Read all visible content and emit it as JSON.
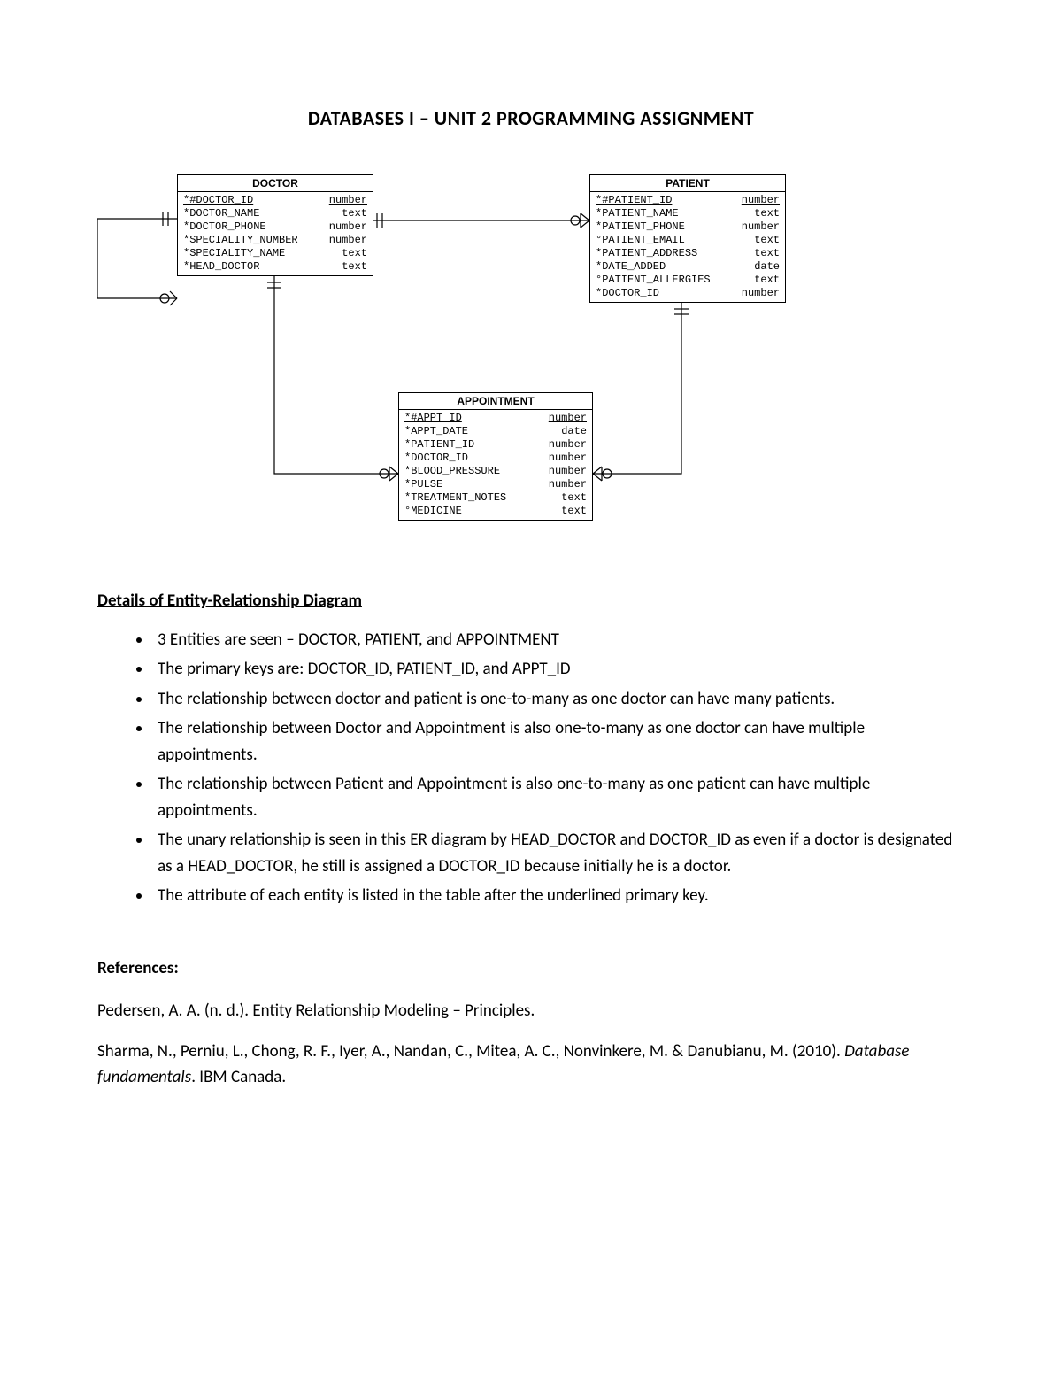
{
  "title": "DATABASES I – UNIT 2 PROGRAMMING ASSIGNMENT",
  "entities": {
    "doctor": {
      "name": "DOCTOR",
      "attributes": [
        {
          "prefix": "*#",
          "name": "DOCTOR_ID",
          "type": "number",
          "pk": true
        },
        {
          "prefix": "*",
          "name": "DOCTOR_NAME",
          "type": "text",
          "pk": false
        },
        {
          "prefix": "*",
          "name": "DOCTOR_PHONE",
          "type": "number",
          "pk": false
        },
        {
          "prefix": "*",
          "name": "SPECIALITY_NUMBER",
          "type": "number",
          "pk": false
        },
        {
          "prefix": "*",
          "name": "SPECIALITY_NAME",
          "type": "text",
          "pk": false
        },
        {
          "prefix": "*",
          "name": "HEAD_DOCTOR",
          "type": "text",
          "pk": false
        }
      ]
    },
    "patient": {
      "name": "PATIENT",
      "attributes": [
        {
          "prefix": "*#",
          "name": "PATIENT_ID",
          "type": "number",
          "pk": true
        },
        {
          "prefix": "*",
          "name": "PATIENT_NAME",
          "type": "text",
          "pk": false
        },
        {
          "prefix": "*",
          "name": "PATIENT_PHONE",
          "type": "number",
          "pk": false
        },
        {
          "prefix": "°",
          "name": "PATIENT_EMAIL",
          "type": "text",
          "pk": false
        },
        {
          "prefix": "*",
          "name": "PATIENT_ADDRESS",
          "type": "text",
          "pk": false
        },
        {
          "prefix": "*",
          "name": "DATE_ADDED",
          "type": "date",
          "pk": false
        },
        {
          "prefix": "°",
          "name": "PATIENT_ALLERGIES",
          "type": "text",
          "pk": false
        },
        {
          "prefix": "*",
          "name": "DOCTOR_ID",
          "type": "number",
          "pk": false
        }
      ]
    },
    "appointment": {
      "name": "APPOINTMENT",
      "attributes": [
        {
          "prefix": "*#",
          "name": "APPT_ID",
          "type": "number",
          "pk": true
        },
        {
          "prefix": "*",
          "name": "APPT_DATE",
          "type": "date",
          "pk": false
        },
        {
          "prefix": "*",
          "name": "PATIENT_ID",
          "type": "number",
          "pk": false
        },
        {
          "prefix": "*",
          "name": "DOCTOR_ID",
          "type": "number",
          "pk": false
        },
        {
          "prefix": "*",
          "name": "BLOOD_PRESSURE",
          "type": "number",
          "pk": false
        },
        {
          "prefix": "*",
          "name": "PULSE",
          "type": "number",
          "pk": false
        },
        {
          "prefix": "*",
          "name": "TREATMENT_NOTES",
          "type": "text",
          "pk": false
        },
        {
          "prefix": "°",
          "name": "MEDICINE",
          "type": "text",
          "pk": false
        }
      ]
    }
  },
  "details_heading": "Details of Entity-Relationship Diagram",
  "details": [
    "3 Entities are seen – DOCTOR, PATIENT, and APPOINTMENT",
    "The primary keys are: DOCTOR_ID, PATIENT_ID, and APPT_ID",
    "The relationship between doctor and patient is one-to-many as one doctor can have many patients.",
    "The relationship between Doctor and Appointment is also one-to-many as one doctor can have multiple appointments.",
    "The relationship between Patient and Appointment is also one-to-many as one patient can have multiple appointments.",
    "The unary relationship is seen in this ER diagram by HEAD_DOCTOR and DOCTOR_ID as even if a doctor is designated as a HEAD_DOCTOR, he still is assigned a DOCTOR_ID because initially he is a doctor.",
    "The attribute of each entity is listed in the table after the underlined primary key."
  ],
  "references_heading": "References:",
  "references": [
    {
      "text": "Pedersen, A. A. (n. d.). Entity Relationship Modeling – Principles."
    },
    {
      "text": "Sharma, N., Perniu, L., Chong, R. F., Iyer, A., Nandan, C., Mitea, A. C., Nonvinkere, M. & Danubianu, M. (2010). ",
      "italic": "Database fundamentals",
      "tail": ". IBM Canada."
    }
  ]
}
